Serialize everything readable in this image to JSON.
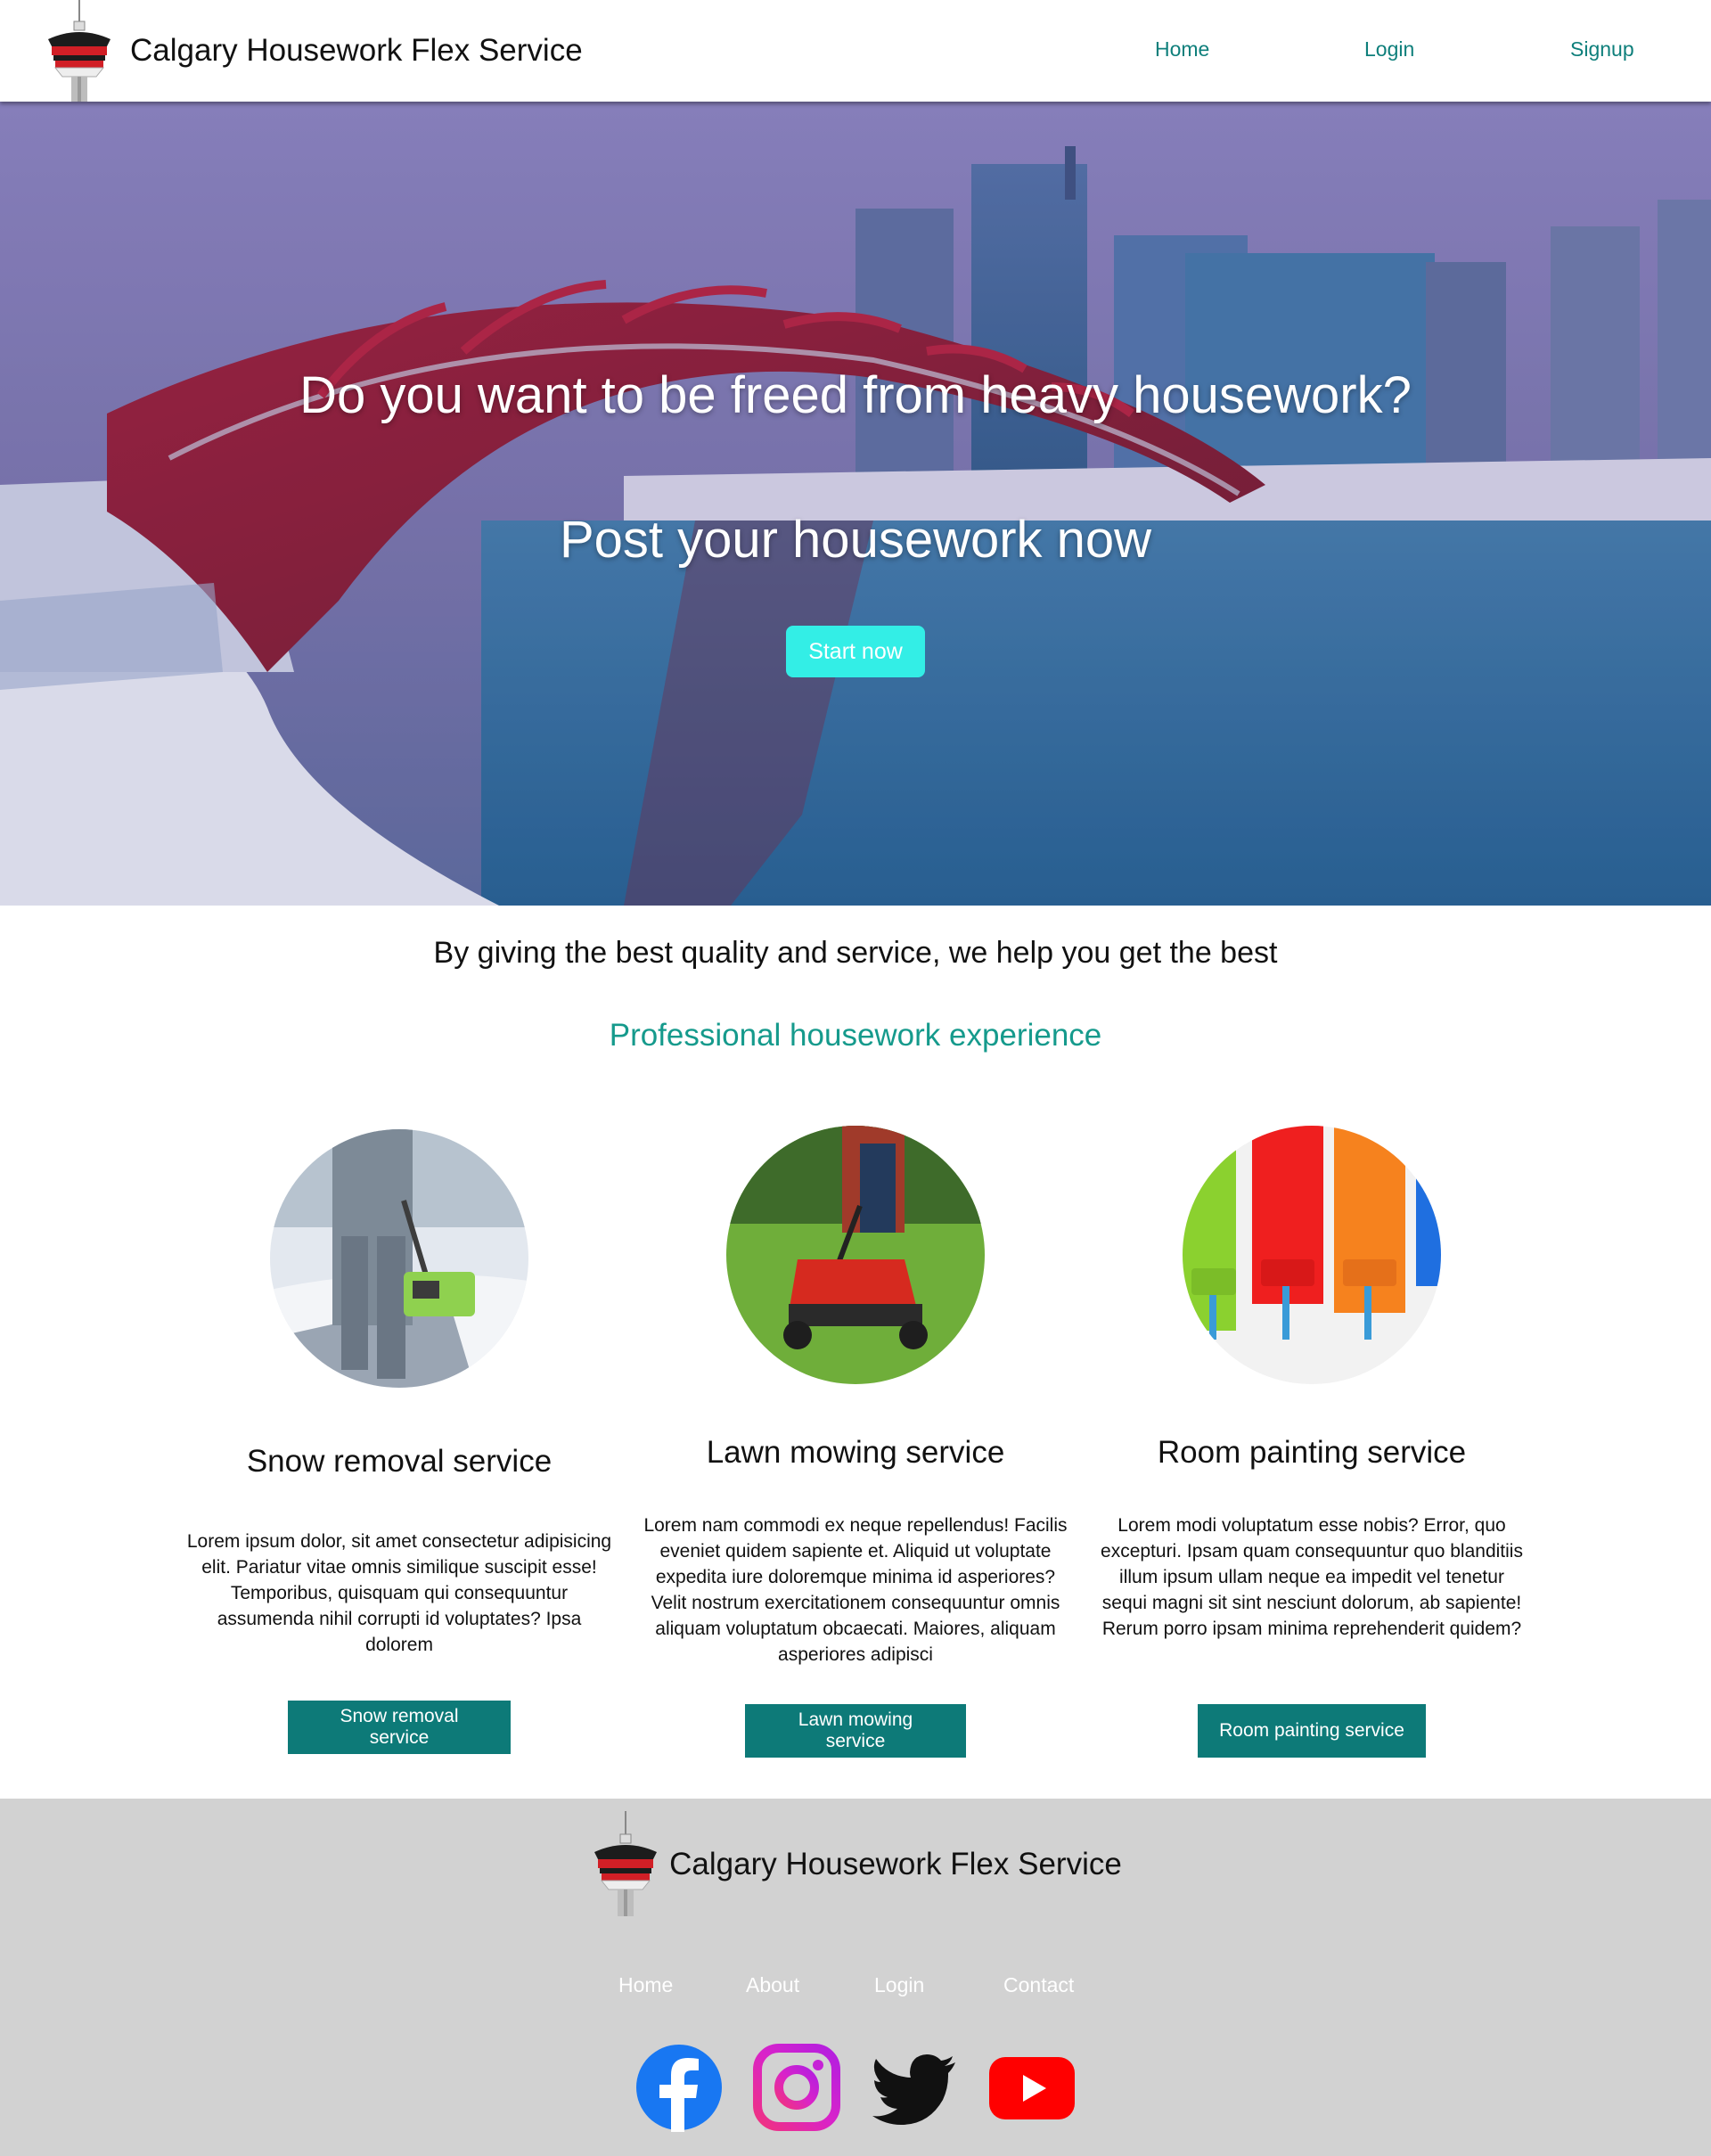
{
  "header": {
    "brand_name": "Calgary Housework Flex Service",
    "logo_icon": "calgary-tower-icon",
    "nav": [
      {
        "label": "Home"
      },
      {
        "label": "Login"
      },
      {
        "label": "Signup"
      }
    ]
  },
  "hero": {
    "title": "Do you want to be freed from heavy housework?",
    "subtitle": "Post your housework now",
    "cta_label": "Start now",
    "background_icon": "peace-bridge-winter-photo"
  },
  "intro": {
    "tagline": "By giving the best quality and service, we help you get the best",
    "subtagline": "Professional housework experience"
  },
  "services": [
    {
      "photo_icon": "snow-removal-photo",
      "title": "Snow removal service",
      "description": "Lorem ipsum dolor, sit amet consectetur adipisicing elit. Pariatur vitae omnis similique suscipit esse! Temporibus, quisquam qui consequuntur assumenda nihil corrupti id voluptates? Ipsa dolorem",
      "button_label": "Snow removal service"
    },
    {
      "photo_icon": "lawn-mowing-photo",
      "title": "Lawn mowing service",
      "description": "Lorem nam commodi ex neque repellendus! Facilis eveniet quidem sapiente et. Aliquid ut voluptate expedita iure doloremque minima id asperiores? Velit nostrum exercitationem consequuntur omnis aliquam voluptatum obcaecati. Maiores, aliquam asperiores adipisci",
      "button_label": "Lawn mowing service"
    },
    {
      "photo_icon": "room-painting-photo",
      "title": "Room painting service",
      "description": "Lorem modi voluptatum esse nobis? Error, quo excepturi. Ipsam quam consequuntur quo blanditiis illum ipsum ullam neque ea impedit vel tenetur sequi magni sit sint nesciunt dolorum, ab sapiente! Rerum porro ipsam minima reprehenderit quidem?",
      "button_label": "Room painting service"
    }
  ],
  "footer": {
    "brand_name": "Calgary Housework Flex Service",
    "links": [
      {
        "label": "Home"
      },
      {
        "label": "About"
      },
      {
        "label": "Login"
      },
      {
        "label": "Contact"
      }
    ],
    "social": [
      "facebook-icon",
      "instagram-icon",
      "twitter-icon",
      "youtube-icon"
    ]
  },
  "colors": {
    "accent_teal": "#0d7a78",
    "nav_link": "#0e7f7b",
    "cta": "#33eee6",
    "subtagline": "#159a8c",
    "footer_bg": "#d2d2d2"
  }
}
